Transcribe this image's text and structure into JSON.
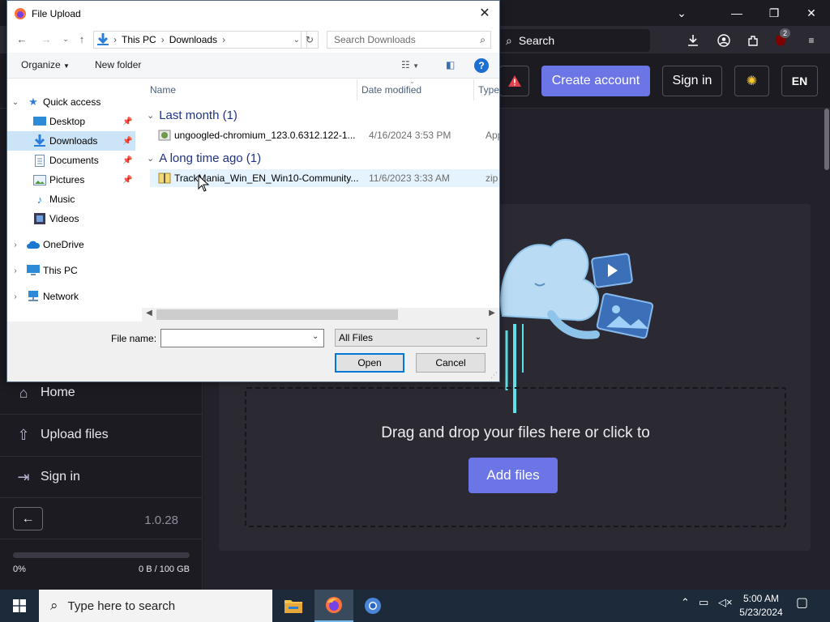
{
  "browser": {
    "search_label": "Search",
    "extension_badge": "2"
  },
  "app": {
    "header": {
      "create_account": "Create account",
      "sign_in": "Sign in",
      "language": "EN"
    },
    "sidebar": {
      "items": [
        {
          "label": "Home",
          "icon": "home-icon"
        },
        {
          "label": "Upload files",
          "icon": "upload-icon"
        },
        {
          "label": "Sign in",
          "icon": "sign-in-icon"
        }
      ],
      "version": "1.0.28",
      "storage_percent_label": "0%",
      "storage_used": "0 B / 100 GB",
      "storage_fraction": 0
    },
    "main": {
      "drop_text": "Drag and drop your files here or click to",
      "add_files": "Add files"
    }
  },
  "dialog": {
    "title": "File Upload",
    "breadcrumb": [
      "This PC",
      "Downloads"
    ],
    "search_placeholder": "Search Downloads",
    "toolbar": {
      "organize": "Organize",
      "new_folder": "New folder"
    },
    "nav": [
      {
        "label": "Quick access",
        "icon": "star-icon",
        "chevron": "⌄",
        "pinned": false,
        "selected": false,
        "indent": 1
      },
      {
        "label": "Desktop",
        "icon": "desktop-icon",
        "chevron": "",
        "pinned": true,
        "selected": false,
        "indent": 2
      },
      {
        "label": "Downloads",
        "icon": "download-icon",
        "chevron": "",
        "pinned": true,
        "selected": true,
        "indent": 2
      },
      {
        "label": "Documents",
        "icon": "documents-icon",
        "chevron": "",
        "pinned": true,
        "selected": false,
        "indent": 2
      },
      {
        "label": "Pictures",
        "icon": "pictures-icon",
        "chevron": "",
        "pinned": true,
        "selected": false,
        "indent": 2
      },
      {
        "label": "Music",
        "icon": "music-icon",
        "chevron": "",
        "pinned": false,
        "selected": false,
        "indent": 2
      },
      {
        "label": "Videos",
        "icon": "videos-icon",
        "chevron": "",
        "pinned": false,
        "selected": false,
        "indent": 2
      },
      {
        "label": "OneDrive",
        "icon": "onedrive-icon",
        "chevron": "›",
        "pinned": false,
        "selected": false,
        "indent": 1
      },
      {
        "label": "This PC",
        "icon": "this-pc-icon",
        "chevron": "›",
        "pinned": false,
        "selected": false,
        "indent": 1
      },
      {
        "label": "Network",
        "icon": "network-icon",
        "chevron": "›",
        "pinned": false,
        "selected": false,
        "indent": 1
      }
    ],
    "columns": {
      "name": "Name",
      "date_modified": "Date modified",
      "type": "Type"
    },
    "groups": [
      {
        "label": "Last month (1)",
        "files": [
          {
            "name": "ungoogled-chromium_123.0.6312.122-1...",
            "date": "4/16/2024 3:53 PM",
            "type": "Appli",
            "icon": "installer-icon"
          }
        ]
      },
      {
        "label": "A long time ago (1)",
        "files": [
          {
            "name": "TrackMania_Win_EN_Win10-Community...",
            "date": "11/6/2023 3:33 AM",
            "type": "zip A",
            "icon": "zip-icon"
          }
        ]
      }
    ],
    "file_name_label": "File name:",
    "file_name_value": "",
    "file_type": "All Files",
    "open": "Open",
    "cancel": "Cancel"
  },
  "taskbar": {
    "search_placeholder": "Type here to search",
    "time": "5:00 AM",
    "date": "5/23/2024"
  }
}
